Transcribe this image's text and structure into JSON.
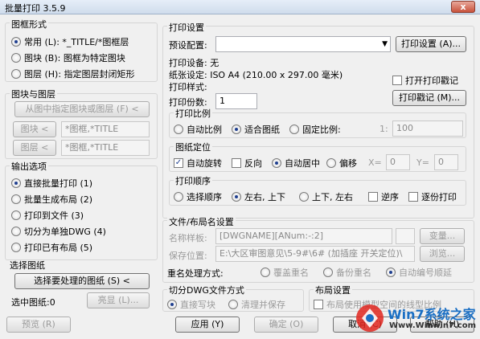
{
  "window": {
    "title": "批量打印 3.5.9",
    "close": "x"
  },
  "frame_style": {
    "title": "图框形式",
    "options": [
      {
        "label": "常用 (L): *_TITLE/*图框层",
        "selected": true
      },
      {
        "label": "图块 (B): 图框为特定图块",
        "selected": false
      },
      {
        "label": "图层 (H): 指定图层封闭矩形",
        "selected": false
      }
    ]
  },
  "block_layer": {
    "title": "图块与图层",
    "pick_button": "从图中指定图块或图层 (F) <",
    "block_button": "图块 <",
    "block_value": "*图框,*TITLE",
    "layer_button": "图层 <",
    "layer_value": "*图框,*TITLE"
  },
  "output": {
    "title": "输出选项",
    "options": [
      {
        "label": "直接批量打印 (1)",
        "selected": true
      },
      {
        "label": "批量生成布局 (2)",
        "selected": false
      },
      {
        "label": "打印到文件 (3)",
        "selected": false
      },
      {
        "label": "切分为单独DWG (4)",
        "selected": false
      },
      {
        "label": "打印已有布局 (5)",
        "selected": false
      }
    ]
  },
  "select_drawing": {
    "title": "选择图纸",
    "button": "选择要处理的图纸 (S) <",
    "selected_label": "选中图纸:0",
    "highlight_button": "亮显 (L)..."
  },
  "print_settings": {
    "title": "打印设置",
    "preset_label": "预设配置:",
    "preset_value": "",
    "setup_button": "打印设置 (A)...",
    "device": "打印设备: 无",
    "paper": "纸张设定: ISO A4 (210.00 x 297.00 毫米)",
    "style_label": "打印样式:",
    "open_stamp_label": "打开打印戳记",
    "copies_label": "打印份数:",
    "copies_value": "1",
    "stamp_button": "打印戳记 (M)..."
  },
  "scale": {
    "title": "打印比例",
    "options": [
      {
        "label": "自动比例",
        "selected": false
      },
      {
        "label": "适合图纸",
        "selected": true
      },
      {
        "label": "固定比例:",
        "selected": false
      }
    ],
    "ratio_left": "1:",
    "ratio_value": "100"
  },
  "position": {
    "title": "图纸定位",
    "auto_rotate": "自动旋转",
    "auto_rotate_checked": true,
    "reverse": "反向",
    "options": [
      {
        "label": "自动居中",
        "selected": true
      },
      {
        "label": "偏移",
        "selected": false
      }
    ],
    "x_label": "X=",
    "x_value": "0",
    "y_label": "Y=",
    "y_value": "0"
  },
  "order": {
    "title": "打印顺序",
    "options": [
      {
        "label": "选择顺序",
        "selected": false
      },
      {
        "label": "左右, 上下",
        "selected": true
      },
      {
        "label": "上下, 左右",
        "selected": false
      }
    ],
    "reverse": "逆序",
    "per_copy": "逐份打印"
  },
  "naming": {
    "title": "文件/布局名设置",
    "template_label": "名称样板:",
    "template_value": "[DWGNAME][ANum:-:2]",
    "change_button": "变量...",
    "location_label": "保存位置:",
    "location_value": "E:\\大区审图意见\\5-9#\\6# (加插座 开关定位)\\",
    "browse_button": "浏览...",
    "rename_label": "重名处理方式:",
    "rename_options": [
      {
        "label": "覆盖重名",
        "selected": false
      },
      {
        "label": "备份重名",
        "selected": false
      },
      {
        "label": "自动编号顺延",
        "selected": true
      }
    ]
  },
  "split": {
    "title": "切分DWG文件方式",
    "options": [
      {
        "label": "直接写块",
        "selected": true
      },
      {
        "label": "清理并保存",
        "selected": false
      }
    ]
  },
  "layout": {
    "title": "布局设置",
    "use_model_label": "布局使用模型空间的线型比例"
  },
  "bottom": {
    "preview": "预览 (R)",
    "apply": "应用 (Y)",
    "ok": "确定 (O)",
    "cancel": "取消 (C)",
    "help": "帮助 (H)"
  },
  "watermark": {
    "brand": "Win7系统之家",
    "url": "Www.Winwin7.com"
  },
  "colors": {
    "win7_blue": "#1a6fc4",
    "win7_red": "#e0261f"
  }
}
